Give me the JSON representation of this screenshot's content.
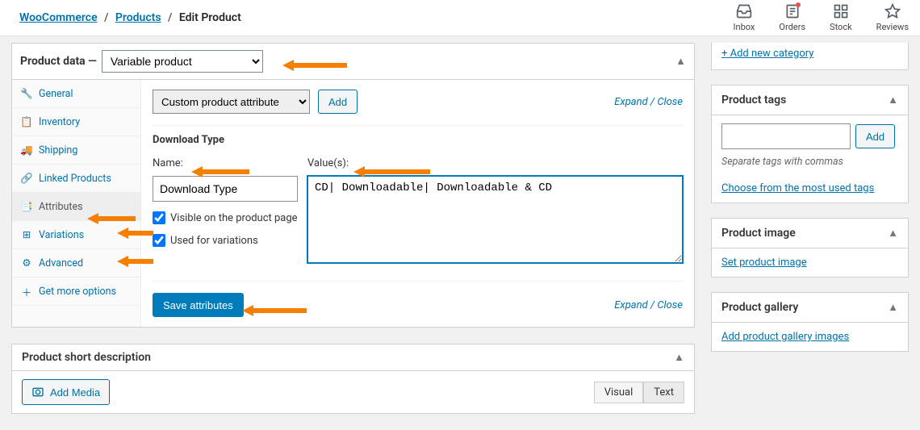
{
  "breadcrumb": {
    "root": "WooCommerce",
    "mid": "Products",
    "current": "Edit Product"
  },
  "topbar": {
    "inbox": "Inbox",
    "orders": "Orders",
    "stock": "Stock",
    "reviews": "Reviews"
  },
  "product_data": {
    "title": "Product data —",
    "type_select": "Variable product",
    "tabs": {
      "general": "General",
      "inventory": "Inventory",
      "shipping": "Shipping",
      "linked": "Linked Products",
      "attributes": "Attributes",
      "variations": "Variations",
      "advanced": "Advanced",
      "get_more": "Get more options"
    },
    "attribute_select": "Custom product attribute",
    "add_btn": "Add",
    "expand_close": "Expand / Close",
    "attr_title": "Download Type",
    "name_label": "Name:",
    "name_value": "Download Type",
    "values_label": "Value(s):",
    "values_value": "CD| Downloadable| Downloadable & CD",
    "visible_label": "Visible on the product page",
    "used_label": "Used for variations",
    "save_btn": "Save attributes"
  },
  "short_desc": {
    "title": "Product short description",
    "add_media": "Add Media",
    "visual": "Visual",
    "text": "Text"
  },
  "category": {
    "add_link": "+ Add new category"
  },
  "tags": {
    "title": "Product tags",
    "add_btn": "Add",
    "hint": "Separate tags with commas",
    "choose_link": "Choose from the most used tags"
  },
  "image": {
    "title": "Product image",
    "link": "Set product image"
  },
  "gallery": {
    "title": "Product gallery",
    "link": "Add product gallery images"
  }
}
